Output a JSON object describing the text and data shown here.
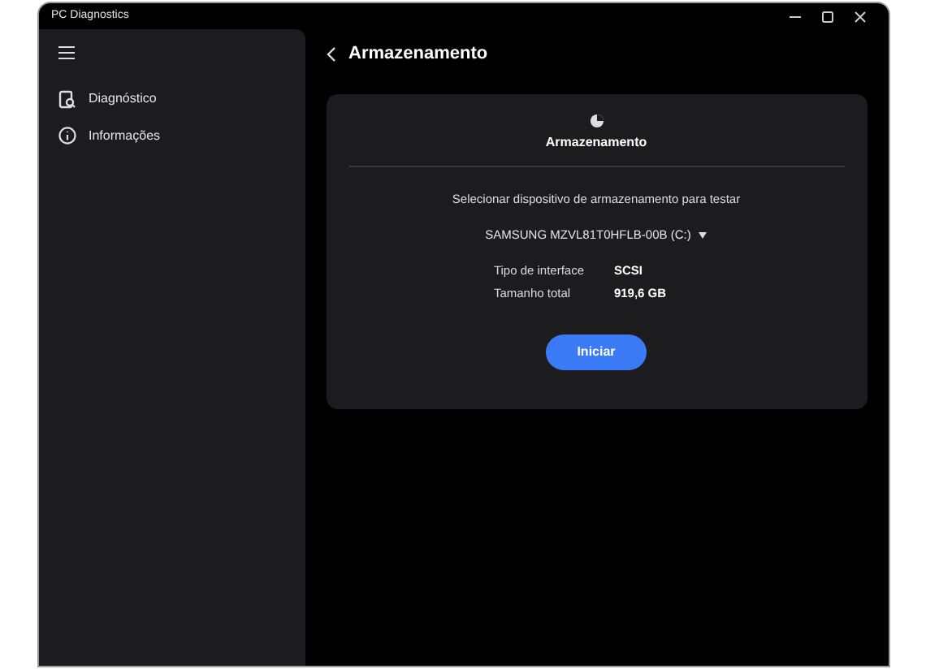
{
  "window": {
    "title": "PC Diagnostics"
  },
  "sidebar": {
    "items": [
      {
        "kind": "diagnostics",
        "label": "Diagnóstico"
      },
      {
        "kind": "info",
        "label": "Informações"
      }
    ]
  },
  "page": {
    "title": "Armazenamento"
  },
  "card": {
    "title": "Armazenamento",
    "prompt": "Selecionar dispositivo de armazenamento para testar",
    "device": "SAMSUNG MZVL81T0HFLB-00B (C:)",
    "details": [
      {
        "label": "Tipo de interface",
        "value": "SCSI"
      },
      {
        "label": "Tamanho total",
        "value": "919,6 GB"
      }
    ],
    "button": "Iniciar"
  }
}
